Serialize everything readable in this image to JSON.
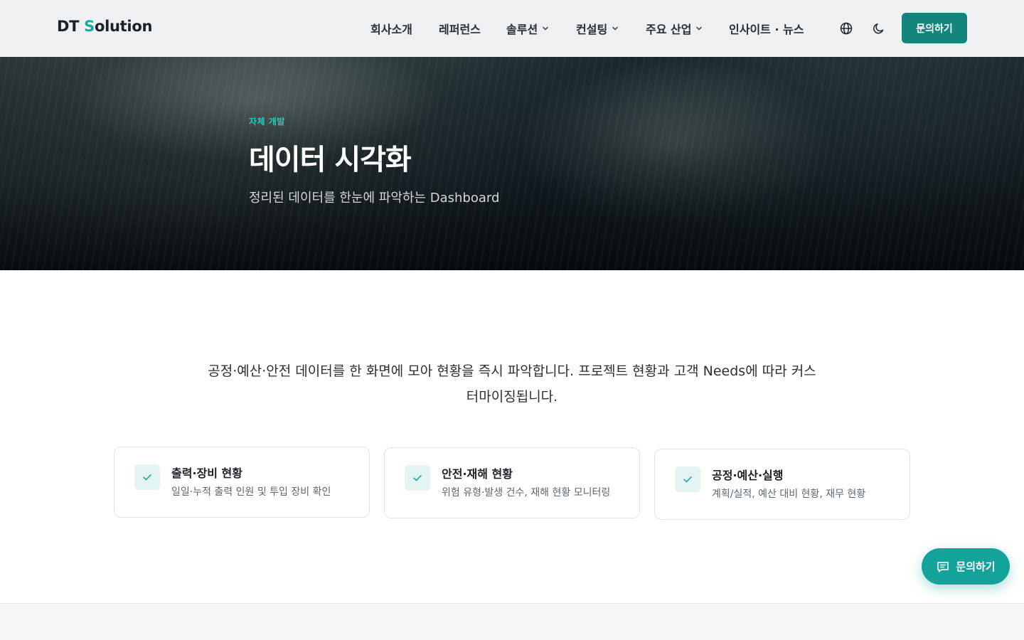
{
  "header": {
    "logo_prefix": "DT ",
    "logo_accent": "S",
    "logo_suffix": "olution",
    "nav": [
      {
        "label": "회사소개",
        "dropdown": false
      },
      {
        "label": "레퍼런스",
        "dropdown": false
      },
      {
        "label": "솔루션",
        "dropdown": true
      },
      {
        "label": "컨설팅",
        "dropdown": true
      },
      {
        "label": "주요 산업",
        "dropdown": true
      },
      {
        "label": "인사이트 · 뉴스",
        "dropdown": false
      }
    ],
    "icons": [
      "globe-icon",
      "moon-icon"
    ],
    "cta_label": "문의하기"
  },
  "hero": {
    "kicker": "자체 개발",
    "title": "데이터 시각화",
    "subtitle": "정리된 데이터를 한눈에 파악하는 Dashboard"
  },
  "main": {
    "description": "공정·예산·안전 데이터를 한 화면에 모아 현황을 즉시 파악합니다. 프로젝트 현황과 고객 Needs에 따라 커스터마이징됩니다.",
    "features": [
      {
        "title": "출력·장비 현황",
        "desc": "일일·누적 출력 인원 및 투입 장비 확인"
      },
      {
        "title": "안전·재해 현황",
        "desc": "위험 유형·발생 건수, 재해 현황 모니터링"
      },
      {
        "title": "공정·예산·실행",
        "desc": "계획/실적, 예산 대비 현황, 재무 현황"
      }
    ]
  },
  "floating": {
    "label": "문의하기"
  },
  "colors": {
    "brand": "#16a99f",
    "cta": "#13857d",
    "kicker": "#2ec7bb"
  }
}
